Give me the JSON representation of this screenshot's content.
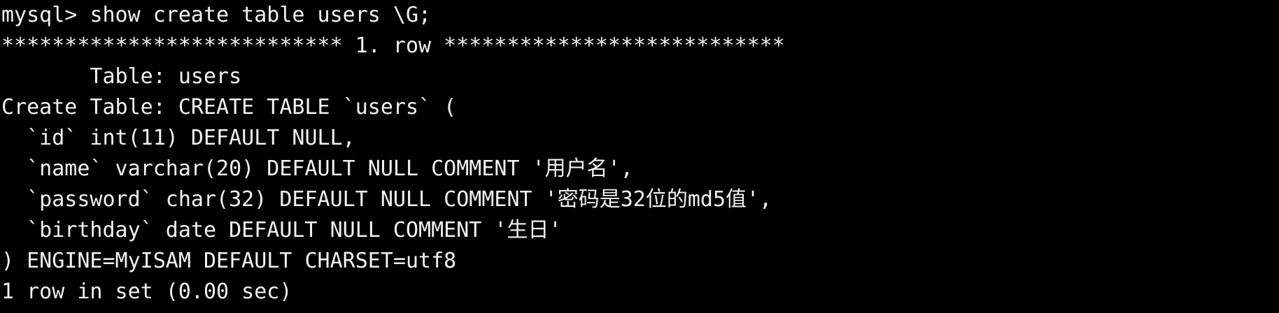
{
  "terminal": {
    "prompt": "mysql> ",
    "command": "show create table users \\G;",
    "separator": "*************************** 1. row ***************************",
    "table_line": "       Table: users",
    "create_line": "Create Table: CREATE TABLE `users` (",
    "col_id": "  `id` int(11) DEFAULT NULL,",
    "col_name": "  `name` varchar(20) DEFAULT NULL COMMENT '用户名',",
    "col_password": "  `password` char(32) DEFAULT NULL COMMENT '密码是32位的md5值',",
    "col_birthday": "  `birthday` date DEFAULT NULL COMMENT '生日'",
    "engine_line": ") ENGINE=MyISAM DEFAULT CHARSET=utf8",
    "result_line": "1 row in set (0.00 sec)"
  },
  "colors": {
    "background": "#000000",
    "text": "#f2f2f2"
  }
}
